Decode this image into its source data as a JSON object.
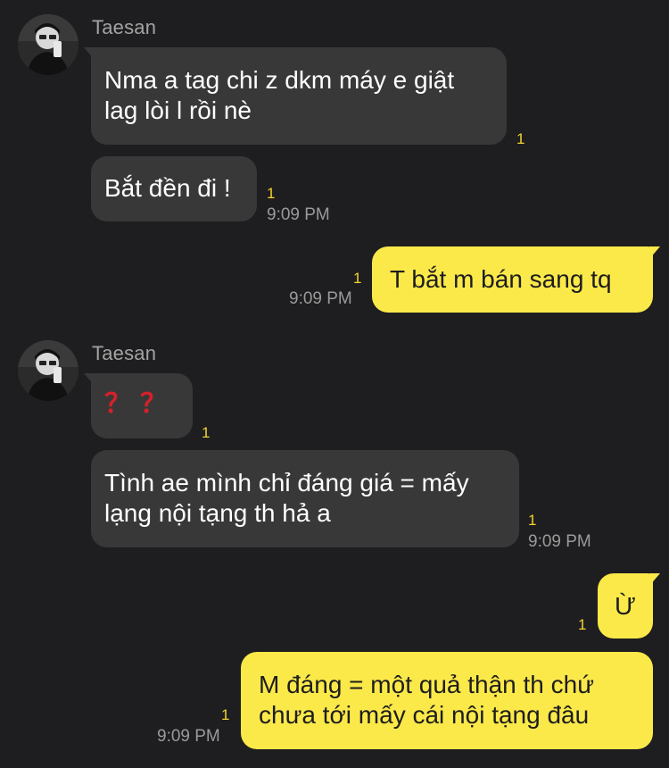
{
  "groups": [
    {
      "sender": "Taesan",
      "avatar_icon": "profile-photo-avatar",
      "messages": [
        {
          "text": "Nma a tag chi z dkm máy e giật\nlag lòi l rồi nè",
          "unread": "1",
          "time": ""
        },
        {
          "text": "Bắt đền đi !",
          "unread": "1",
          "time": "9:09 PM"
        }
      ]
    },
    {
      "sender": "Taesan",
      "avatar_icon": "profile-photo-avatar",
      "messages": [
        {
          "text": "？？",
          "unread": "1",
          "time": ""
        },
        {
          "text": "Tình ae mình chỉ đáng giá = mấy\nlạng nội tạng th hả a",
          "unread": "1",
          "time": "9:09 PM"
        }
      ]
    }
  ],
  "outgoing": [
    {
      "text": "T bắt m bán sang tq",
      "unread": "1",
      "time": "9:09 PM"
    },
    {
      "text": "Ừ",
      "unread": "1",
      "time": ""
    },
    {
      "text": "M đáng = một quả thận th chứ\nchưa tới mấy cái nội tạng đâu",
      "unread": "1",
      "time": "9:09 PM"
    }
  ],
  "colors": {
    "background": "#1e1e20",
    "incoming_bubble": "#383839",
    "outgoing_bubble": "#fbe94a",
    "unread_count": "#f2d22e",
    "question_marks": "#d8202a"
  }
}
